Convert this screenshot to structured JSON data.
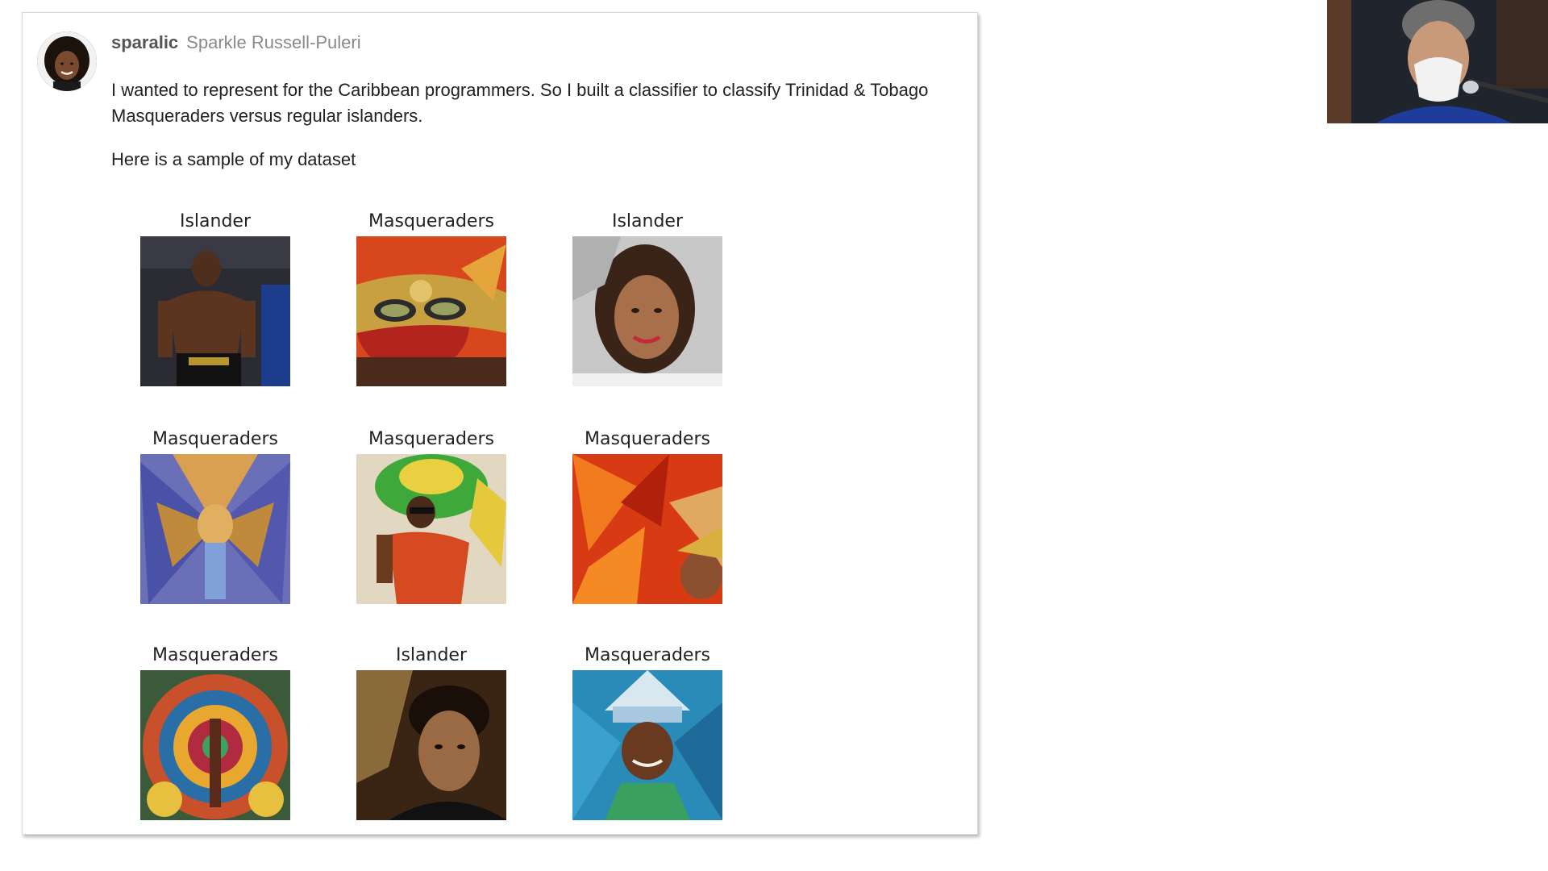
{
  "post": {
    "username": "sparalic",
    "fullname": "Sparkle Russell-Puleri",
    "paragraph1": "I wanted to represent for the Caribbean programmers. So I built a classifier to classify Trinidad & Tobago Masqueraders versus regular islanders.",
    "paragraph2": "Here is a sample of my dataset"
  },
  "grid": {
    "items": [
      {
        "label": "Islander"
      },
      {
        "label": "Masqueraders"
      },
      {
        "label": "Islander"
      },
      {
        "label": "Masqueraders"
      },
      {
        "label": "Masqueraders"
      },
      {
        "label": "Masqueraders"
      },
      {
        "label": "Masqueraders"
      },
      {
        "label": "Islander"
      },
      {
        "label": "Masqueraders"
      }
    ]
  }
}
